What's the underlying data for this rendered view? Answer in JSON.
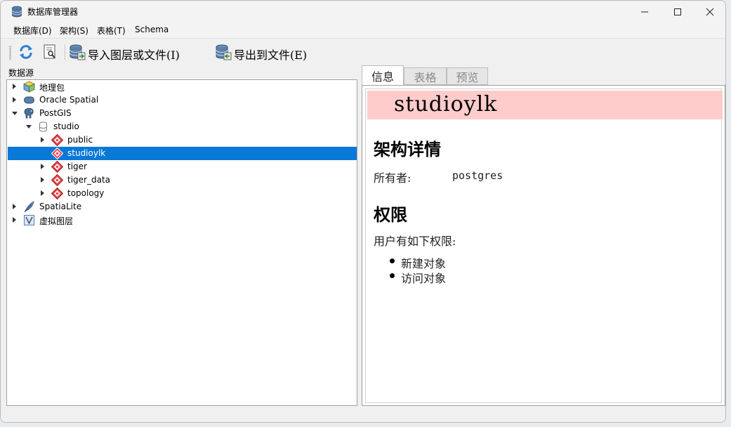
{
  "window": {
    "title": "数据库管理器"
  },
  "menubar": {
    "items": [
      {
        "label": "数据库(D)"
      },
      {
        "label": "架构(S)"
      },
      {
        "label": "表格(T)"
      },
      {
        "label": "Schema"
      }
    ]
  },
  "toolbar": {
    "import_label": "导入图层或文件(I)",
    "export_label": "导出到文件(E)"
  },
  "left_panel": {
    "title": "数据源",
    "tree": [
      {
        "label": "地理包"
      },
      {
        "label": "Oracle Spatial"
      },
      {
        "label": "PostGIS"
      },
      {
        "label": "studio"
      },
      {
        "label": "public"
      },
      {
        "label": "studioylk"
      },
      {
        "label": "tiger"
      },
      {
        "label": "tiger_data"
      },
      {
        "label": "topology"
      },
      {
        "label": "SpatiaLite"
      },
      {
        "label": "虚拟图层"
      }
    ]
  },
  "tabs": [
    {
      "label": "信息"
    },
    {
      "label": "表格"
    },
    {
      "label": "预览"
    }
  ],
  "info": {
    "banner": "studioylk",
    "schema_heading": "架构详情",
    "owner_label": "所有者:",
    "owner_value": "postgres",
    "privileges_heading": "权限",
    "privileges_intro": "用户有如下权限:",
    "privileges": [
      "新建对象",
      "访问对象"
    ]
  }
}
